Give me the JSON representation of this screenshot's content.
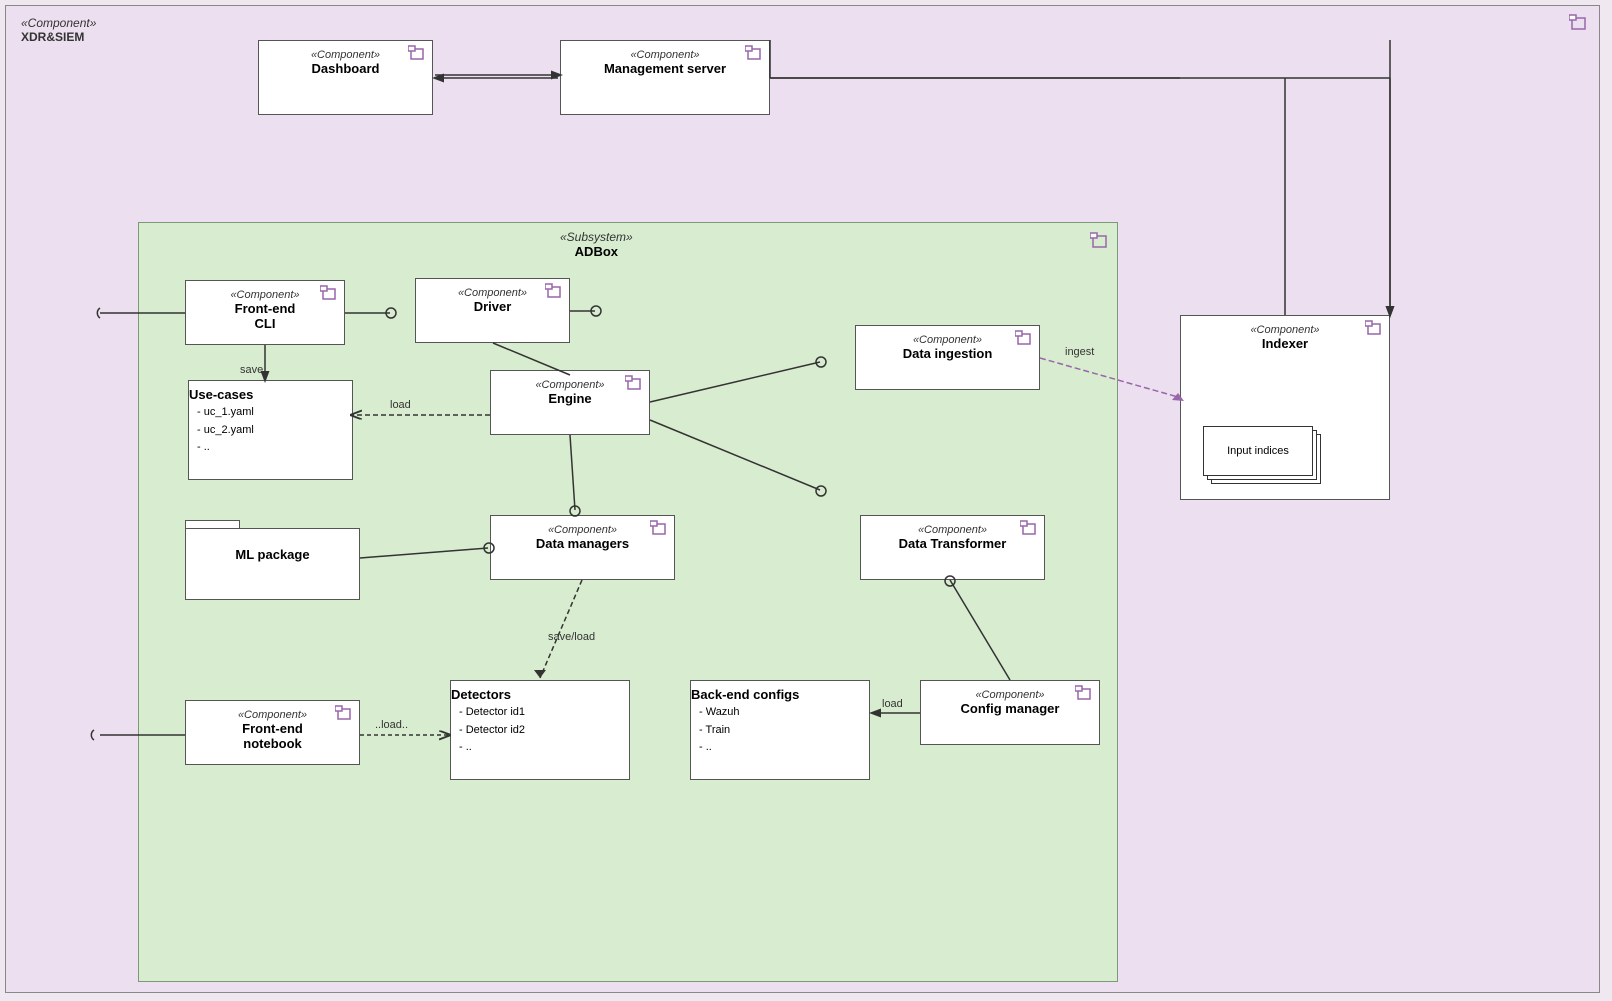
{
  "diagram": {
    "title": "XDR&SIEM",
    "outerStereotype": "«Component»",
    "adbox": {
      "stereotype": "«Subsystem»",
      "name": "ADBox"
    },
    "components": {
      "dashboard": {
        "stereotype": "«Component»",
        "name": "Dashboard"
      },
      "mgmtServer": {
        "stereotype": "«Component»",
        "name": "Management server"
      },
      "indexer": {
        "stereotype": "«Component»",
        "name": "Indexer"
      },
      "frontendCli": {
        "stereotype": "«Component»",
        "name": "Front-end\nCLI"
      },
      "driver": {
        "stereotype": "«Component»",
        "name": "Driver"
      },
      "engine": {
        "stereotype": "«Component»",
        "name": "Engine"
      },
      "dataIngestion": {
        "stereotype": "«Component»",
        "name": "Data ingestion"
      },
      "useCases": {
        "name": "Use-cases",
        "items": [
          "- uc_1.yaml",
          "- uc_2.yaml",
          "- .."
        ]
      },
      "mlPackage": {
        "name": "ML package"
      },
      "dataManagers": {
        "stereotype": "«Component»",
        "name": "Data managers"
      },
      "dataTransformer": {
        "stereotype": "«Component»",
        "name": "Data Transformer"
      },
      "detectors": {
        "name": "Detectors",
        "items": [
          "- Detector id1",
          "- Detector id2",
          "- .."
        ]
      },
      "backendConfigs": {
        "name": "Back-end configs",
        "items": [
          "- Wazuh",
          "- Train",
          "- .."
        ]
      },
      "configManager": {
        "stereotype": "«Component»",
        "name": "Config manager"
      },
      "frontendNotebook": {
        "stereotype": "«Component»",
        "name": "Front-end\nnotebook"
      }
    },
    "inputIndices": "Input indices",
    "labels": {
      "save": "save",
      "load": "load",
      "saveLoad": "save/load",
      "ingest": "ingest",
      "loadDotted": "..load.."
    }
  }
}
